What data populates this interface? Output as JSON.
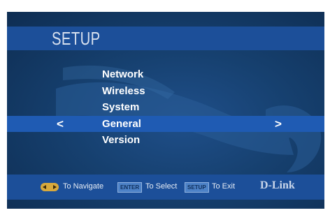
{
  "header": {
    "title": "SETUP"
  },
  "menu": {
    "items": [
      {
        "label": "Network"
      },
      {
        "label": "Wireless"
      },
      {
        "label": "System"
      },
      {
        "label": "General"
      },
      {
        "label": "Version"
      }
    ],
    "selected_index": 3,
    "left_arrow": "<",
    "right_arrow": ">"
  },
  "footer": {
    "navigate_icon": "dpad-icon",
    "navigate_label": "To Navigate",
    "enter_key": "ENTER",
    "select_label": "To Select",
    "setup_key": "SETUP",
    "exit_label": "To Exit",
    "brand": "D-Link"
  },
  "colors": {
    "background": "#16406f",
    "bar": "#1c4f99",
    "highlight": "#1f5bb3",
    "text": "#ffffff"
  }
}
